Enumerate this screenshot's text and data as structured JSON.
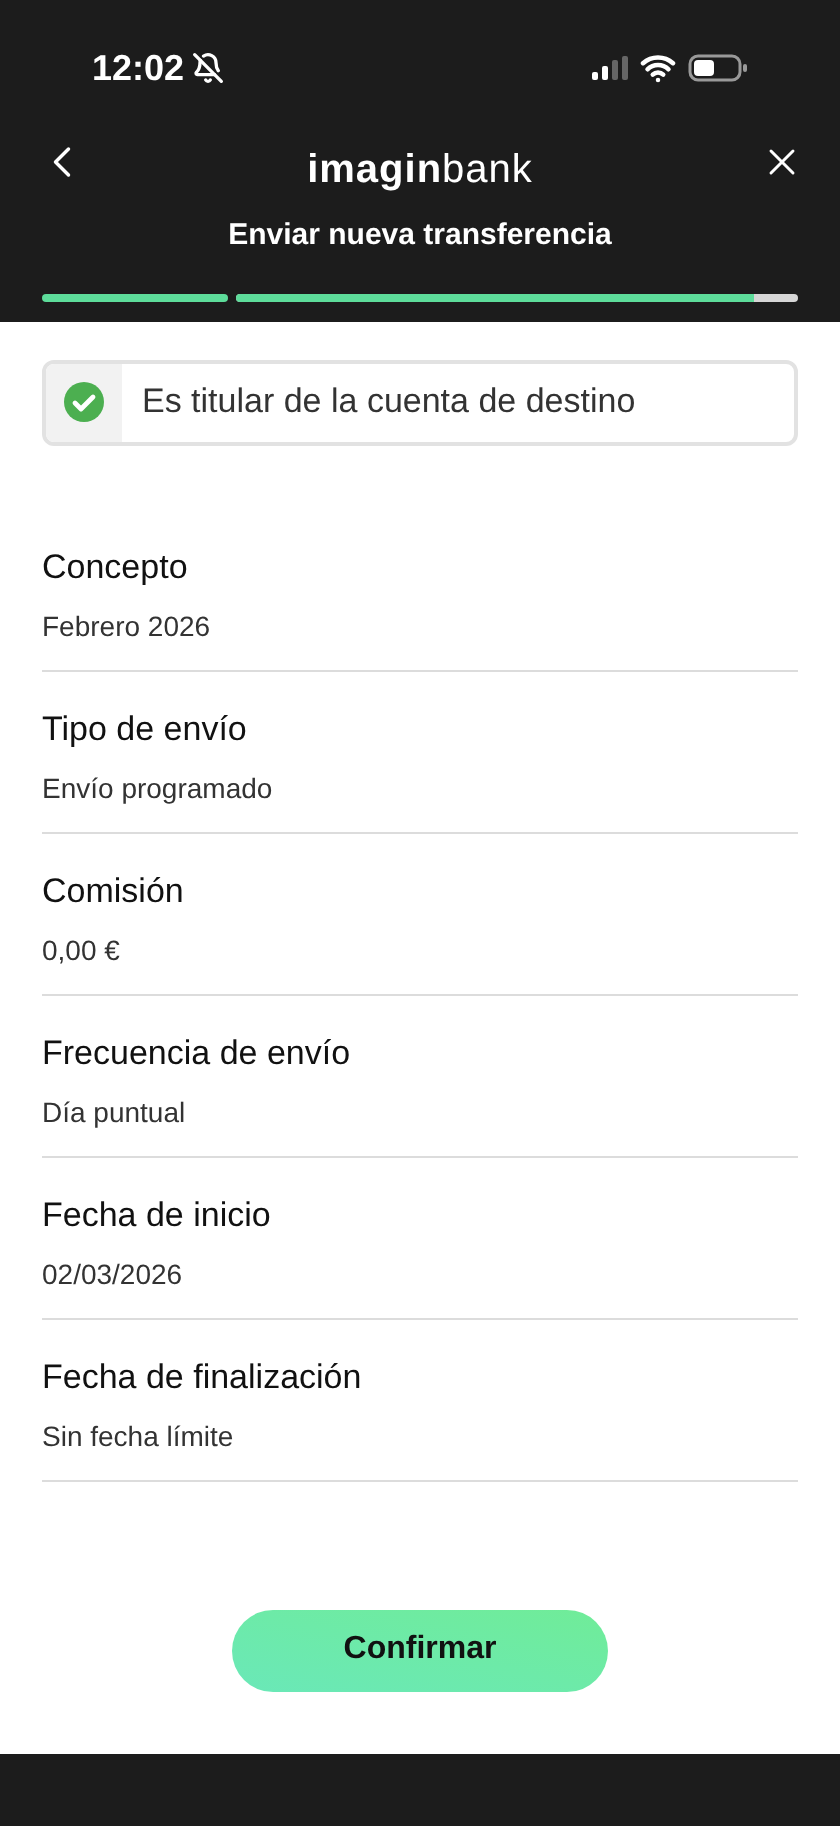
{
  "status_bar": {
    "time": "12:02"
  },
  "header": {
    "logo": "**imagin**bank",
    "title": "Enviar nueva transferencia"
  },
  "progress": [
    {
      "completed": true
    },
    {
      "completed": false,
      "level": 0.92
    }
  ],
  "owner_check": {
    "label": "Es titular de la cuenta de destino",
    "checked": true
  },
  "details": [
    {
      "label": "Concepto",
      "value": "Febrero 2026"
    },
    {
      "label": "Tipo de envío",
      "value": "Envío programado"
    },
    {
      "label": "Comisión",
      "value": "0,00 €"
    },
    {
      "label": "Frecuencia de envío",
      "value": "Día puntual"
    },
    {
      "label": "Fecha de inicio",
      "value": "02/03/2026"
    },
    {
      "label": "Fecha de finalización",
      "value": "Sin fecha límite"
    }
  ],
  "confirm_button": "Confirmar"
}
